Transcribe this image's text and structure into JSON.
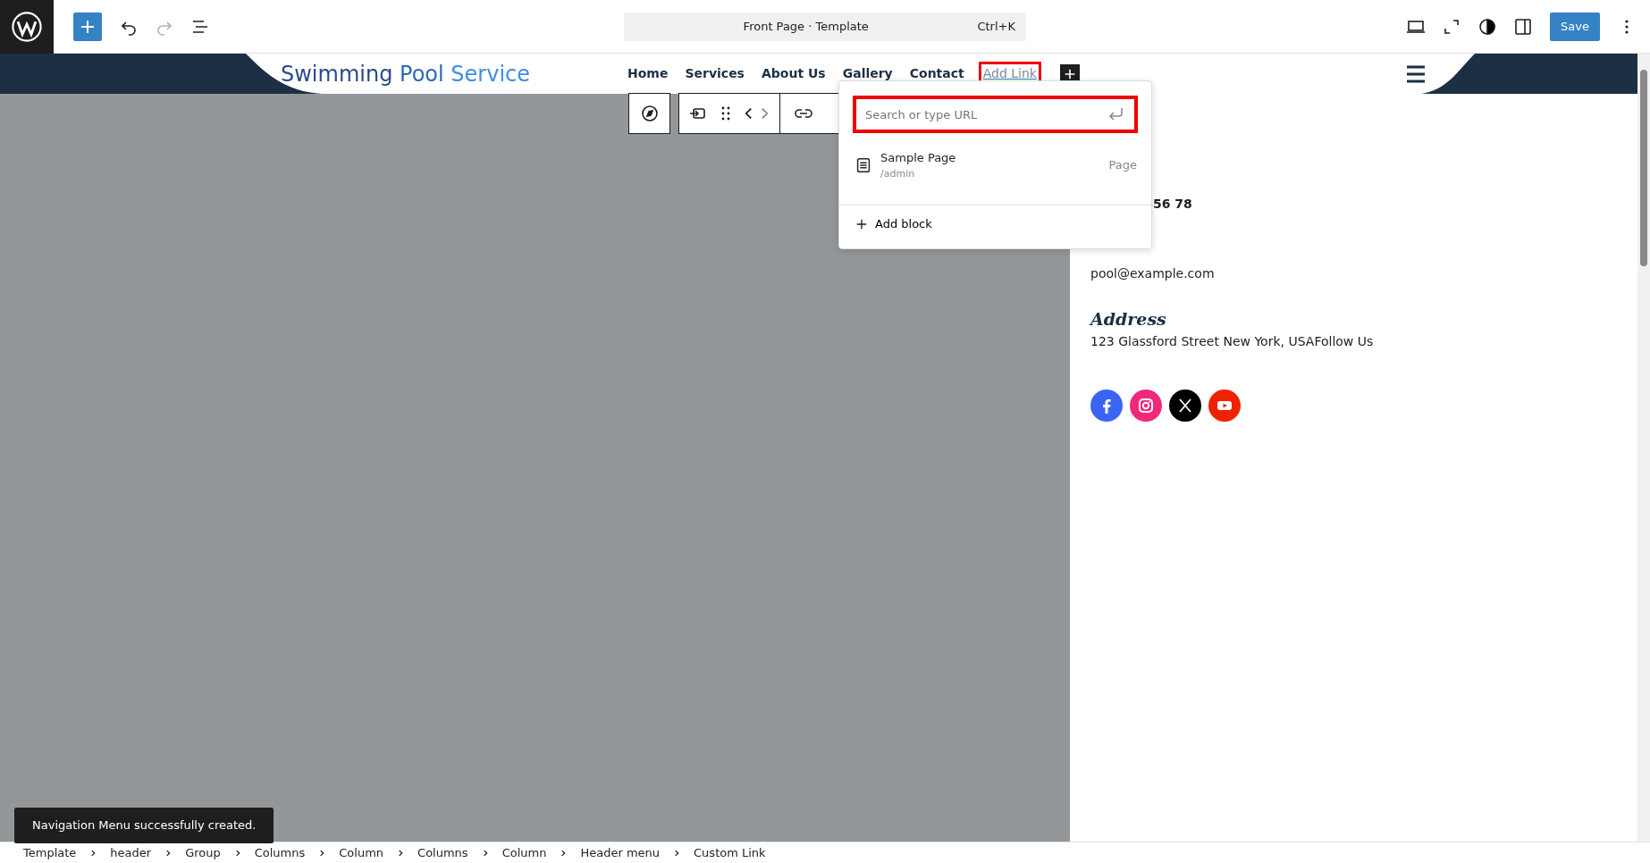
{
  "top_bar": {
    "left_tools": [
      {
        "kind": "add",
        "disabled": false
      },
      {
        "kind": "undo",
        "disabled": false
      },
      {
        "kind": "redo",
        "disabled": true
      },
      {
        "kind": "list",
        "disabled": false
      }
    ],
    "command_bar": {
      "title": "Front Page · Template",
      "shortcut": "Ctrl+K"
    },
    "right_tools": [
      {
        "kind": "desktop"
      },
      {
        "kind": "fullscreen"
      },
      {
        "kind": "contrast"
      },
      {
        "kind": "sidebar"
      }
    ],
    "save_button": "Save"
  },
  "site_header": {
    "title_words": [
      {
        "text": "Swimming",
        "color": "#2b4a8c"
      },
      {
        "text": "Pool",
        "color": "#2f68b5"
      },
      {
        "text": "Service",
        "color": "#3d8fde"
      }
    ],
    "nav": [
      {
        "label": "Home",
        "kind": "link",
        "selected": false
      },
      {
        "label": "Services",
        "kind": "link",
        "selected": false
      },
      {
        "label": "About Us",
        "kind": "link",
        "selected": false
      },
      {
        "label": "Gallery",
        "kind": "link",
        "selected": false
      },
      {
        "label": "Contact",
        "kind": "link",
        "selected": false
      },
      {
        "label": "Add Link",
        "kind": "draft",
        "selected": true
      }
    ]
  },
  "link_popup": {
    "placeholder": "Search or type URL",
    "highlighted": true,
    "results": [
      {
        "title": "Sample Page",
        "path": "/admin",
        "type": "Page"
      }
    ],
    "add_block": "Add block"
  },
  "contact": {
    "phone": "56 78",
    "email": "pool@example.com",
    "address_heading": "Address",
    "address": "123 Glassford Street New York, USAFollow Us",
    "social": [
      {
        "kind": "facebook",
        "color": "#3b64f5"
      },
      {
        "kind": "instagram",
        "color": "#f0287c"
      },
      {
        "kind": "x",
        "color": "#000000"
      },
      {
        "kind": "youtube",
        "color": "#ee2200"
      }
    ]
  },
  "toast": "Navigation Menu successfully created.",
  "breadcrumbs": [
    "Template",
    "header",
    "Group",
    "Columns",
    "Column",
    "Columns",
    "Column",
    "Header menu",
    "Custom Link"
  ]
}
